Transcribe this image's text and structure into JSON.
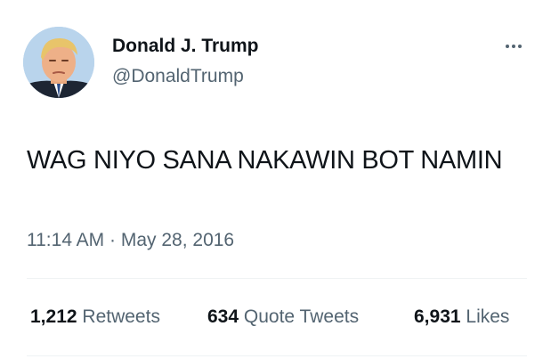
{
  "author": {
    "name": "Donald J. Trump",
    "handle": "@DonaldTrump",
    "avatar_icon": "profile-photo"
  },
  "more_icon": "more-horizontal-icon",
  "tweet": {
    "text": "WAG NIYO SANA NAKAWIN BOT NAMIN",
    "time": "11:14 AM",
    "separator": "·",
    "date": "May 28, 2016"
  },
  "stats": {
    "retweets": {
      "count": "1,212",
      "label": "Retweets"
    },
    "quote_tweets": {
      "count": "634",
      "label": "Quote Tweets"
    },
    "likes": {
      "count": "6,931",
      "label": "Likes"
    }
  },
  "colors": {
    "text_primary": "#0f1419",
    "text_secondary": "#536471",
    "divider": "#eff3f4"
  }
}
